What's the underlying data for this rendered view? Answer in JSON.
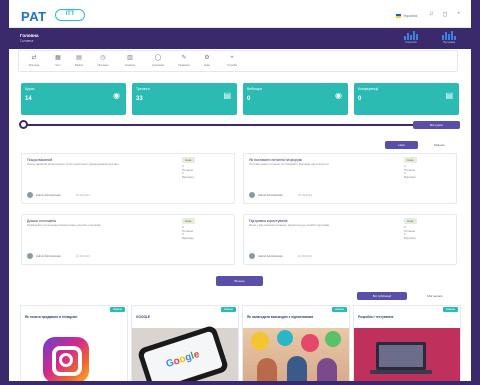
{
  "brand": {
    "logo_text": "PAT",
    "logo_badge": "ITT"
  },
  "topbar": {
    "language": "Україна",
    "icons": [
      "bell-icon",
      "message-icon",
      "user-icon"
    ]
  },
  "header": {
    "title": "Головна",
    "subtitle": "Головна",
    "logos": [
      "Технології",
      "Підтримка"
    ]
  },
  "toolbar": {
    "items": [
      {
        "icon": "arrows-icon",
        "glyph": "⇄",
        "label": "Розклад"
      },
      {
        "icon": "grid-icon",
        "glyph": "▦",
        "label": "Тест"
      },
      {
        "icon": "book-icon",
        "glyph": "▤",
        "label": "Файли"
      },
      {
        "icon": "clock-icon",
        "glyph": "◷",
        "label": "Питання"
      },
      {
        "icon": "calendar-icon",
        "glyph": "▥",
        "label": "Новини"
      },
      {
        "icon": "user-icon",
        "glyph": "◯",
        "label": "Учасники"
      },
      {
        "icon": "pin-icon",
        "glyph": "✎",
        "label": "Правила"
      },
      {
        "icon": "gear-icon",
        "glyph": "⚙",
        "label": "Інфо"
      },
      {
        "icon": "plus-icon",
        "glyph": "+",
        "label": "Служба"
      }
    ]
  },
  "stats": [
    {
      "label": "Курси",
      "value": "14",
      "icon": "camera-icon",
      "glyph": "◉"
    },
    {
      "label": "Тренінги",
      "value": "33",
      "icon": "document-icon",
      "glyph": "▤"
    },
    {
      "label": "Вебінари",
      "value": "0",
      "icon": "camera-icon",
      "glyph": "◉"
    },
    {
      "label": "Конференції",
      "value": "0",
      "icon": "document-icon",
      "glyph": "▤"
    }
  ],
  "slider": {
    "level": 0.0,
    "button_label": "Всі курси"
  },
  "tabs": {
    "active": "Нові",
    "inactive": "Рейтинг"
  },
  "cards": [
    {
      "title": "Пошук вакансій",
      "desc": "Пошук вакансій безкоштовно та без реєстрації. Кращі вакансії для вас.",
      "author": "Admin Administrator",
      "date": "20.09.2021",
      "badge": "Нове",
      "meta": [
        "0",
        "Питання",
        "0",
        "Відповіді"
      ]
    },
    {
      "title": "Як поставити питання на форумі",
      "desc": "Поставте ваше питання та отримайте відповідь від спільноти.",
      "author": "Admin Administrator",
      "date": "20.09.2021",
      "badge": "Нове",
      "meta": [
        "0",
        "Питання",
        "0",
        "Відповіді"
      ]
    },
    {
      "title": "Дошка оголошень",
      "desc": "Розміщуйте оголошення безкоштовно для всіх учасників.",
      "author": "Admin Administrator",
      "date": "20.09.2021",
      "badge": "Нове",
      "meta": [
        "0",
        "Питання",
        "0",
        "Відповіді"
      ]
    },
    {
      "title": "Підтримка користувачів",
      "desc": "Якщо у вас виникли питання, зверніться до служби підтримки.",
      "author": "Admin Administrator",
      "date": "20.09.2021",
      "badge": "Нове",
      "meta": [
        "0",
        "Питання",
        "0",
        "Відповіді"
      ]
    }
  ],
  "more_button": "Більше",
  "post_tabs": {
    "active": "Всі публікації",
    "inactive": "Мої записи"
  },
  "posts": [
    {
      "tag": "Новини",
      "title": "Як почати продавати в Instagram"
    },
    {
      "tag": "Новини",
      "title": "GOOGLE"
    },
    {
      "tag": "Новини",
      "title": "Як налагодити взаємодію з підписниками"
    },
    {
      "tag": "Новини",
      "title": "Розробка і тестування"
    }
  ],
  "colors": {
    "primary": "#3b2a6b",
    "accent": "#2bbbb3",
    "button": "#5a4fa8"
  }
}
